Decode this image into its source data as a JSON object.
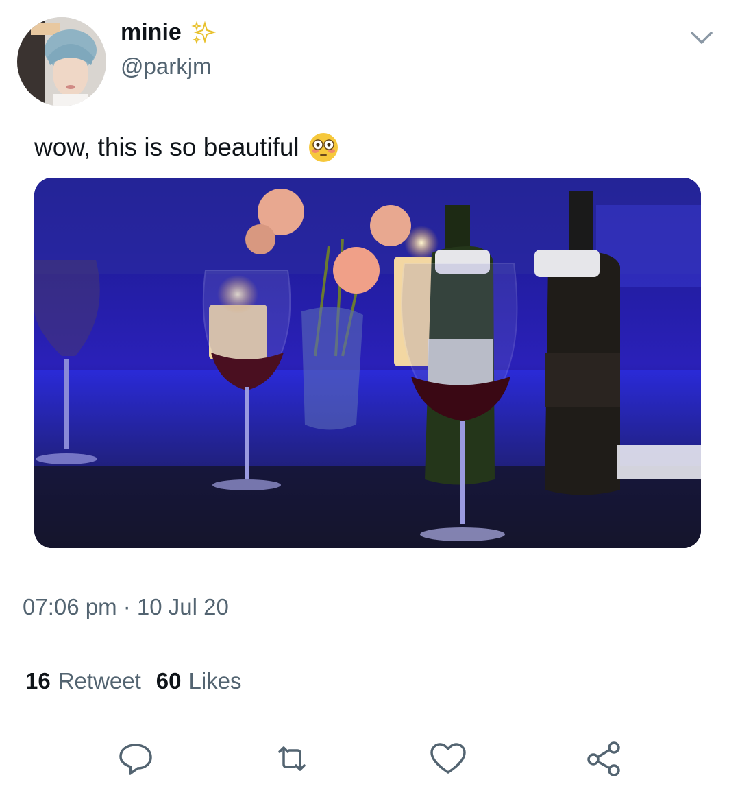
{
  "user": {
    "display_name": "minie",
    "handle": "@parkjm",
    "name_emoji": "sparkles-emoji"
  },
  "tweet": {
    "text": "wow, this is so beautiful",
    "text_emoji": "flushed-face-emoji",
    "media": "photo of wine glasses, candles and flowers on a table",
    "timestamp": "07:06 pm · 10 Jul 20"
  },
  "stats": {
    "retweet_count": "16",
    "retweet_label": "Retweet",
    "like_count": "60",
    "like_label": "Likes"
  },
  "actions": [
    "reply-icon",
    "retweet-icon",
    "like-icon",
    "share-icon"
  ],
  "colors": {
    "text_primary": "#0f1419",
    "text_secondary": "#536471",
    "divider": "#dfe3e6",
    "icon": "#536471"
  }
}
